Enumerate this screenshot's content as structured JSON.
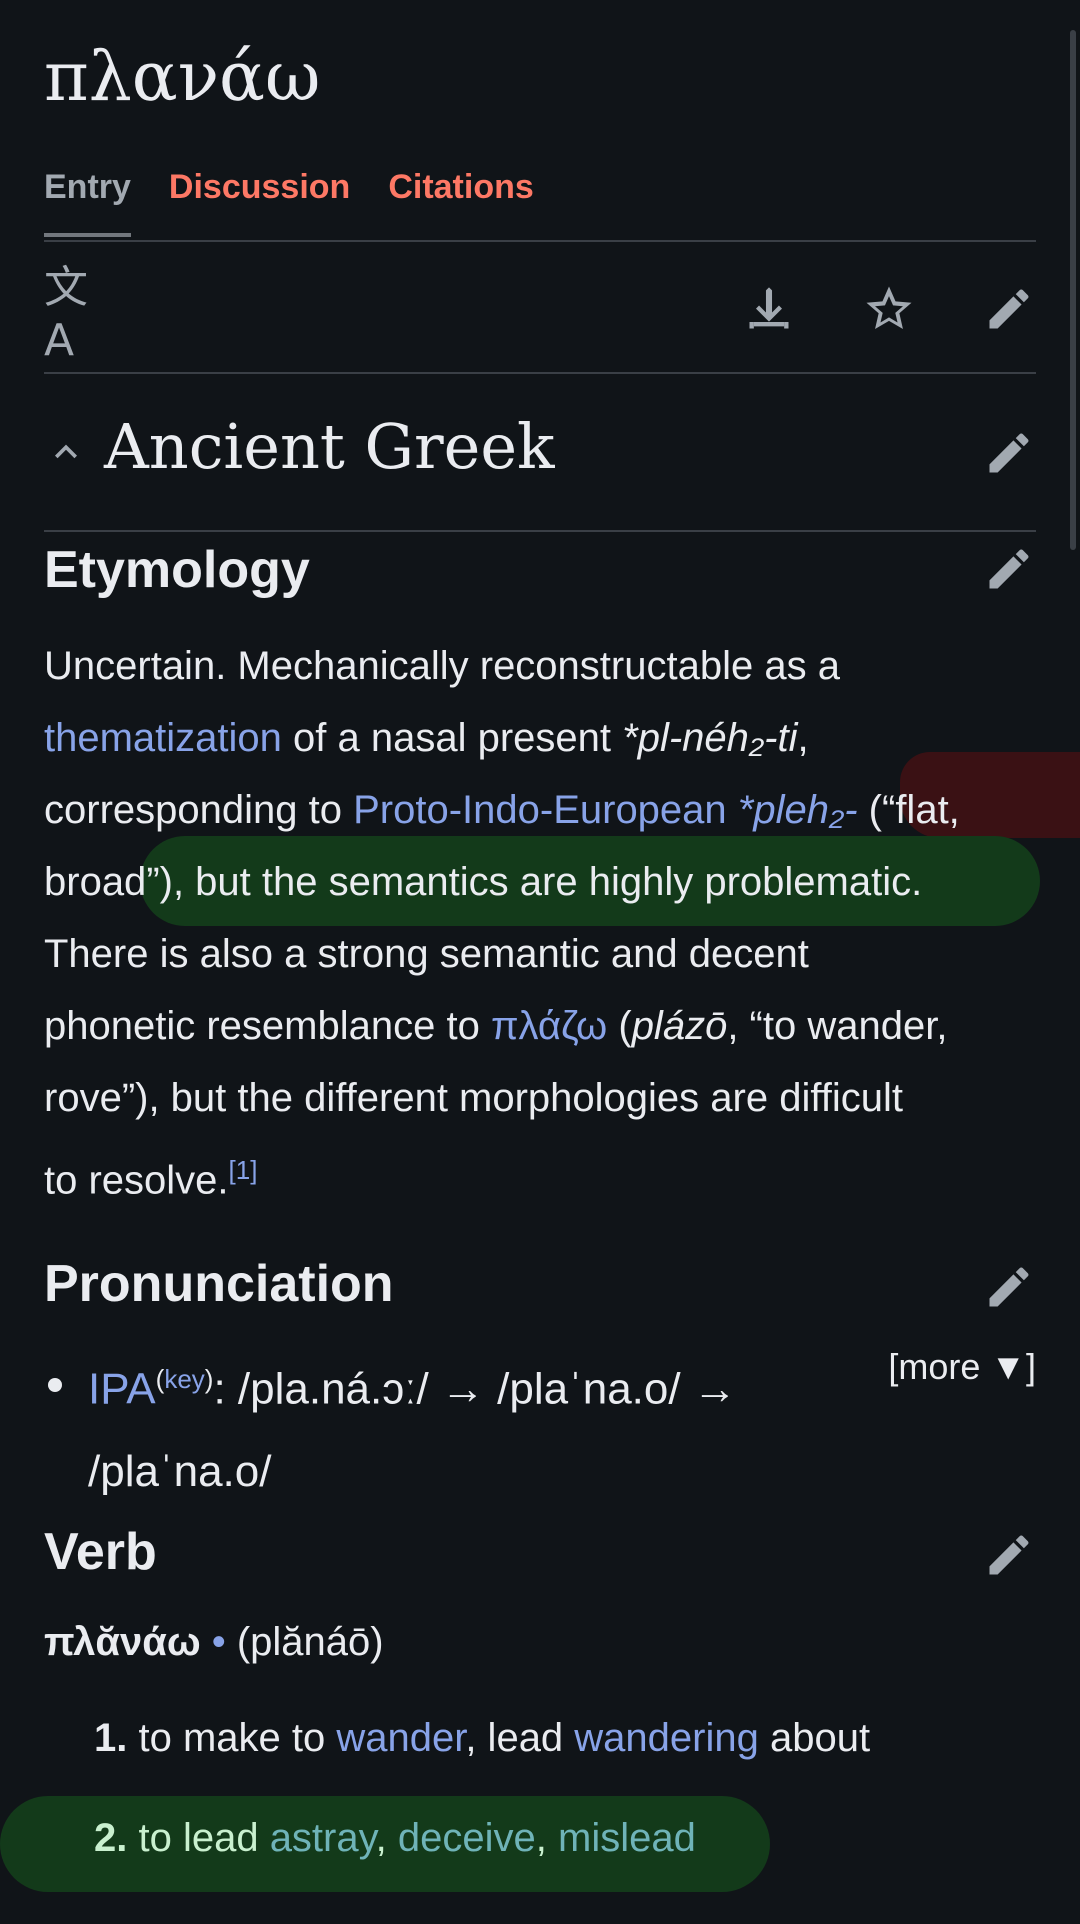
{
  "page": {
    "title": "πλανάω"
  },
  "tabs": [
    {
      "label": "Entry",
      "active": true
    },
    {
      "label": "Discussion"
    },
    {
      "label": "Citations"
    }
  ],
  "toolbar": {
    "language_icon": "translate-icon",
    "icons": [
      "download-icon",
      "star-icon",
      "edit-icon"
    ],
    "lang_glyph": "文A"
  },
  "section": {
    "heading": "Ancient Greek"
  },
  "etymology": {
    "heading": "Etymology",
    "p1": "Uncertain. Mechanically reconstructable as a",
    "link_thematization": "thematization",
    "p2": " of a nasal present ",
    "form1": "*pl-néh₂-ti",
    "comma": ",",
    "p3": "corresponding to ",
    "link_pie": "Proto-Indo-European",
    "pie_form": "*pleh₂-",
    "p4": " (“flat,",
    "p5a": "broad",
    "p5b": "”), but the semantics are highly problematic.",
    "p6": "There is also a strong semantic and decent",
    "p7": "phonetic resemblance to ",
    "link_plazo": "πλάζω",
    "p8a": " (",
    "p8b": "plázō",
    "p8c": ", “to wander,",
    "p9": "rove”), but the different morphologies are difficult",
    "p10": "to resolve.",
    "ref": "[1]"
  },
  "pronunciation": {
    "heading": "Pronunciation",
    "ipa_label": "IPA",
    "key_label": "key",
    "ipa_line1": ": /pla.ná.ɔː/ → /plaˈna.o/ →",
    "ipa_line2": "/plaˈna.o/",
    "more": "[more ▼]"
  },
  "verb": {
    "heading": "Verb",
    "headword": "πλᾰνάω",
    "dot": " • ",
    "translit": "(plănáō)",
    "senses": [
      {
        "num": "1.",
        "pre": " to make to ",
        "l1": "wander",
        "mid": ", lead ",
        "l2": "wandering",
        "post": " about"
      },
      {
        "num": "2.",
        "pre": " to lead ",
        "l1": "astray",
        "c1": ", ",
        "l2": "deceive",
        "c2": ", ",
        "l3": "mislead"
      }
    ]
  },
  "colors": {
    "link": "#88a3e8",
    "tab_red": "#fd7865",
    "highlight_green": "#133a1a",
    "highlight_red": "#3a1114",
    "background": "#101418"
  }
}
